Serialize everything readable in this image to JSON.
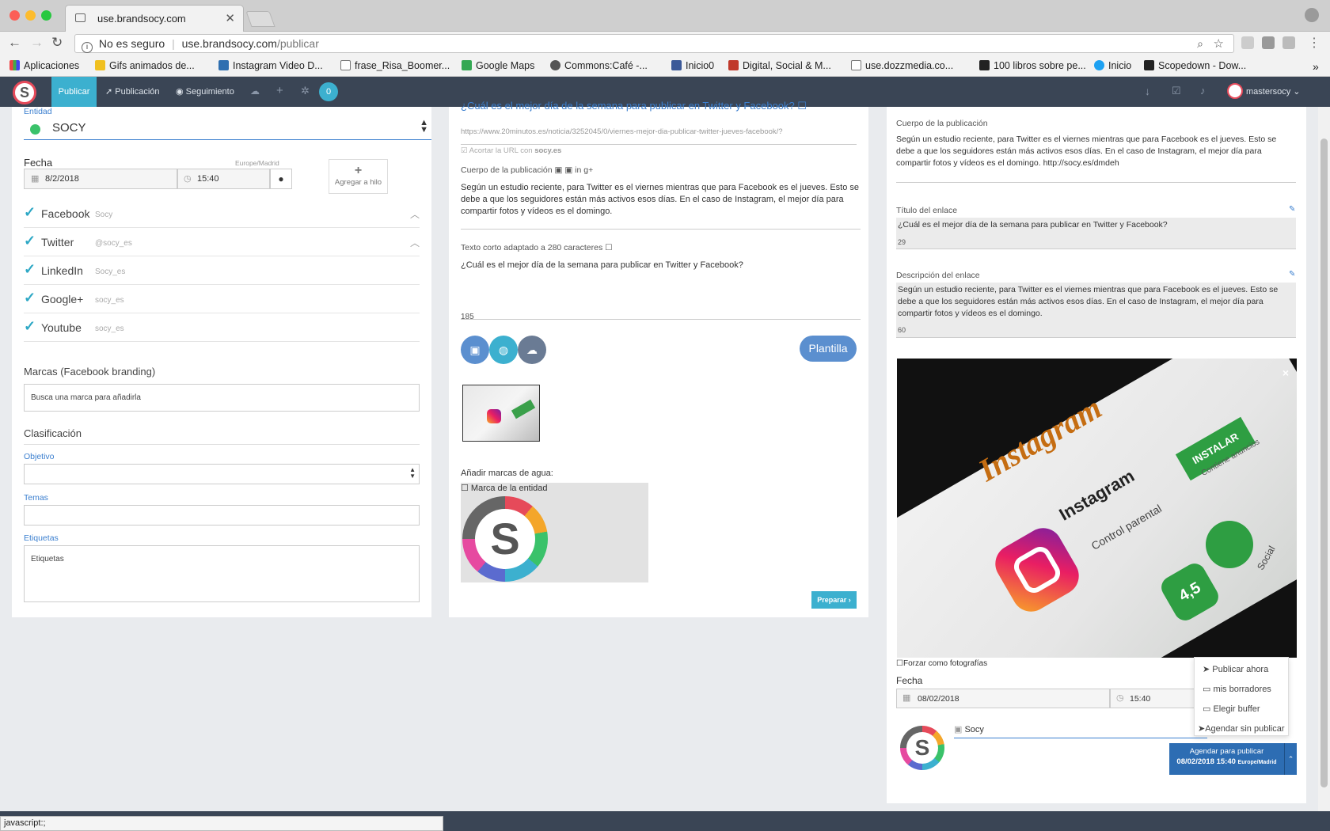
{
  "browser": {
    "tab_title": "use.brandsocy.com",
    "security": "No es seguro",
    "url_host": "use.brandsocy.com",
    "url_path": "/publicar",
    "status_bar": "javascript:;"
  },
  "bookmarks": [
    {
      "label": "Aplicaciones",
      "color": "#d44"
    },
    {
      "label": "Gifs animados de...",
      "color": "#f0c020"
    },
    {
      "label": "Instagram Video D...",
      "color": "#2f6fb0"
    },
    {
      "label": "frase_Risa_Boomer...",
      "color": "#ffffff"
    },
    {
      "label": "Google Maps",
      "color": "#34a853"
    },
    {
      "label": "Commons:Café -...",
      "color": "#555"
    },
    {
      "label": "Inicio0",
      "color": "#3b5998"
    },
    {
      "label": "Digital, Social & M...",
      "color": "#c0392b"
    },
    {
      "label": "use.dozzmedia.co...",
      "color": "#ffffff"
    },
    {
      "label": "100 libros sobre pe...",
      "color": "#222"
    },
    {
      "label": "Inicio",
      "color": "#1da1f2"
    },
    {
      "label": "Scopedown - Dow...",
      "color": "#222"
    }
  ],
  "nav": {
    "publicar": "Publicar",
    "publicacion": "Publicación",
    "seguimiento": "Seguimiento",
    "badge": "0",
    "user": "mastersocy"
  },
  "left": {
    "entidad_label": "Entidad",
    "entidad_value": "SOCY",
    "fecha_label": "Fecha",
    "timezone": "Europe/Madrid",
    "date": "8/2/2018",
    "time": "15:40",
    "hilo": "Agregar a hilo",
    "networks": [
      {
        "name": "Facebook",
        "account": "Socy"
      },
      {
        "name": "Twitter",
        "account": "@socy_es"
      },
      {
        "name": "LinkedIn",
        "account": "Socy_es"
      },
      {
        "name": "Google+",
        "account": "socy_es"
      },
      {
        "name": "Youtube",
        "account": "socy_es"
      }
    ],
    "marcas_title": "Marcas (Facebook branding)",
    "marcas_placeholder": "Busca una marca para añadirla",
    "clasificacion": "Clasificación",
    "objetivo": "Objetivo",
    "temas": "Temas",
    "etiquetas": "Etiquetas",
    "etiquetas_placeholder": "Etiquetas"
  },
  "middle": {
    "link_title": "¿Cuál es el mejor día de la semana para publicar en Twitter y Facebook?",
    "url": "https://www.20minutos.es/noticia/3252045/0/viernes-mejor-dia-publicar-twitter-jueves-facebook/?",
    "shorten": "Acortar la URL con",
    "shorten_domain": "socy.es",
    "cuerpo_label": "Cuerpo de la publicación",
    "cuerpo": "Según un estudio reciente, para Twitter es el viernes mientras que para Facebook es el jueves. Esto se debe a que los seguidores están más activos esos días. En el caso de Instagram, el mejor día para compartir fotos y vídeos es el domingo.",
    "corto_label": "Texto corto adaptado a 280 caracteres",
    "corto": "¿Cuál es el mejor día de la semana para publicar en Twitter y Facebook?",
    "count": "185",
    "plantilla": "Plantilla",
    "marcas_agua": "Añadir marcas de agua:",
    "marca_entidad": "Marca de la entidad",
    "preparar": "Preparar ›"
  },
  "right": {
    "cuerpo_label": "Cuerpo de la publicación",
    "cuerpo": "Según un estudio reciente, para Twitter es el viernes mientras que para Facebook es el jueves. Esto se debe a que los seguidores están más activos esos días. En el caso de Instagram, el mejor día para compartir fotos y vídeos es el domingo. http://socy.es/dmdeh",
    "titulo_label": "Título del enlace",
    "titulo": "¿Cuál es el mejor día de la semana para publicar en Twitter y Facebook?",
    "titulo_count": "29",
    "desc_label": "Descripción del enlace",
    "desc": "Según un estudio reciente, para Twitter es el viernes mientras que para Facebook es el jueves. Esto se debe a que los seguidores están más activos esos días. En el caso de Instagram, el mejor día para compartir fotos y vídeos es el domingo.",
    "desc_count": "60",
    "close": "×",
    "forzar": "Forzar como fotografías",
    "fecha_label": "Fecha",
    "date": "08/02/2018",
    "time": "15:40",
    "account": "Socy",
    "schedule_line1": "Agendar para publicar",
    "schedule_line2": "08/02/2018 15:40",
    "schedule_tz": "Europe/Madrid",
    "dropdown": [
      "Publicar ahora",
      "mis borradores",
      "Elegir buffer",
      "Agendar sin publicar"
    ]
  },
  "image_text": {
    "app_title": "Instagram",
    "install": "INSTALAR",
    "ads": "Contiene anuncios",
    "parental": "Control parental",
    "rating": "4,5",
    "social": "Social",
    "banner": "Instagram"
  }
}
